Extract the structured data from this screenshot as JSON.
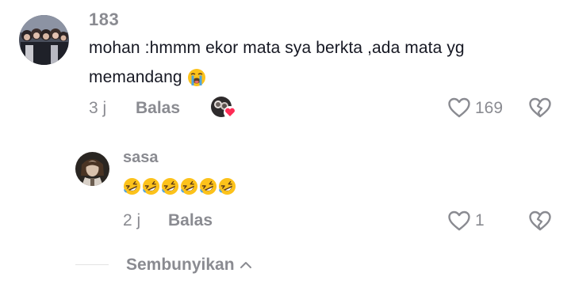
{
  "comment": {
    "username": "183",
    "text_line1": "mohan :hmmm ekor mata sya berkta ,ada mata yg",
    "text_line2": "memandang",
    "trailing_emoji": "loudly-crying-face",
    "time": "3 j",
    "reply_label": "Balas",
    "creator_liked_badge": "creator-liked-avatar-with-heart",
    "like_count": "169"
  },
  "reply": {
    "username": "sasa",
    "emojis": [
      "rolling-on-floor-laughing",
      "rolling-on-floor-laughing",
      "rolling-on-floor-laughing",
      "rolling-on-floor-laughing",
      "rolling-on-floor-laughing",
      "rolling-on-floor-laughing"
    ],
    "time": "2 j",
    "reply_label": "Balas",
    "like_count": "1"
  },
  "footer": {
    "hide_label": "Sembunyikan"
  },
  "colors": {
    "text": "#161823",
    "muted": "#8a8b91",
    "heart_badge": "#fe2c55"
  }
}
